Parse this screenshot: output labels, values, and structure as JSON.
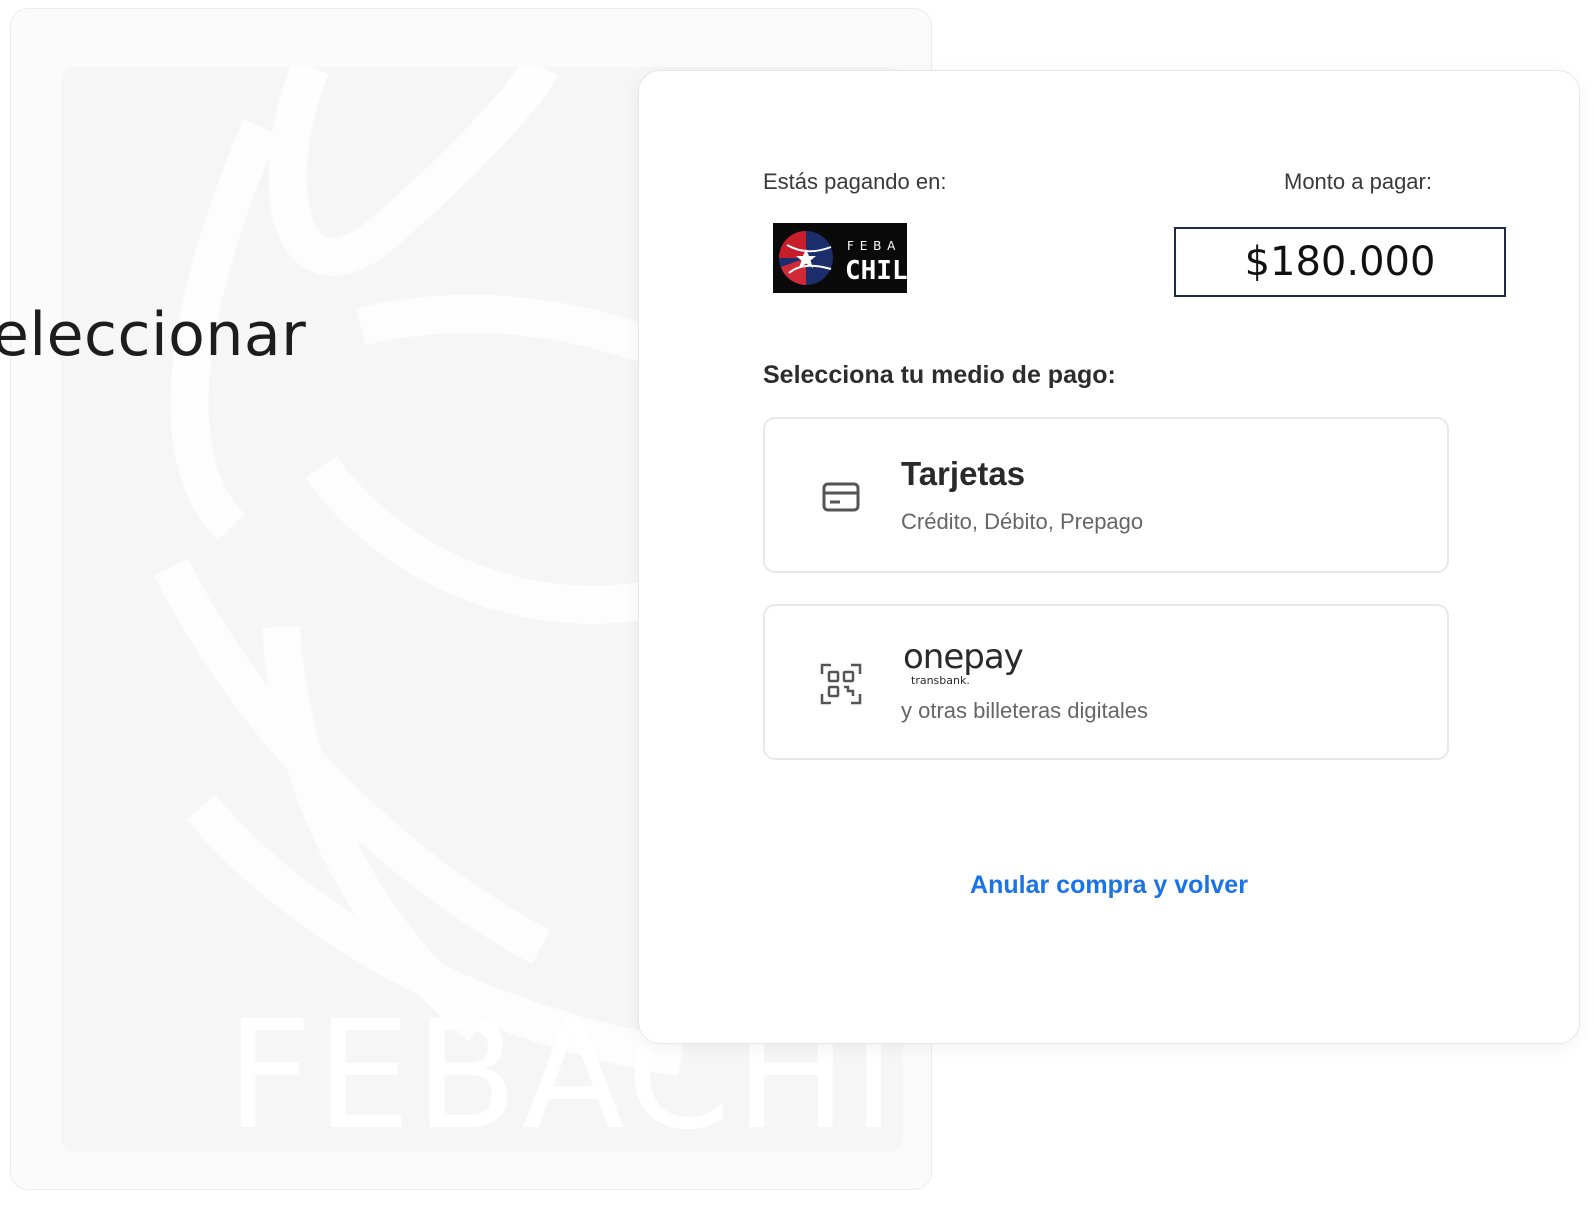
{
  "slide": {
    "word": "eleccionar",
    "watermark_text": "FEBACHILE"
  },
  "checkout": {
    "paying_label": "Estás pagando en:",
    "amount_label": "Monto a pagar:",
    "amount_value": "$180.000",
    "merchant_logo_text": {
      "top": "F E B A",
      "bottom": "CHILE"
    },
    "section_title": "Selecciona tu medio de pago:",
    "methods": [
      {
        "title": "Tarjetas",
        "subtitle": "Crédito, Débito, Prepago",
        "icon": "credit-card-icon"
      },
      {
        "logo_text": "onepay",
        "logo_subtext": "transbank.",
        "subtitle": "y otras billeteras digitales",
        "icon": "qr-code-icon"
      }
    ],
    "cancel_label": "Anular compra y volver"
  },
  "colors": {
    "link": "#1a73e8",
    "amount_border": "#1f2a44",
    "logo_bg": "#0a0a0a"
  }
}
